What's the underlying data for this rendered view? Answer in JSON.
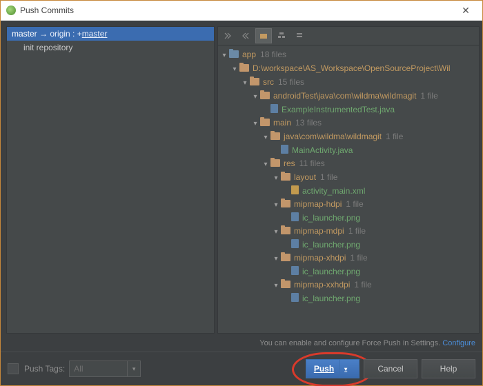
{
  "window": {
    "title": "Push Commits"
  },
  "left": {
    "branch_source": "master",
    "branch_arrow": "→",
    "branch_remote": "origin :",
    "branch_plus": "+",
    "branch_target": "master",
    "commits": [
      "init repository"
    ]
  },
  "tree": [
    {
      "d": 0,
      "exp": true,
      "kind": "F",
      "blue": true,
      "label": "app",
      "count": "18 files"
    },
    {
      "d": 1,
      "exp": true,
      "kind": "F",
      "blue": false,
      "label": "D:\\workspace\\AS_Workspace\\OpenSourceProject\\Wil",
      "count": ""
    },
    {
      "d": 2,
      "exp": true,
      "kind": "F",
      "blue": false,
      "label": "src",
      "count": "15 files"
    },
    {
      "d": 3,
      "exp": true,
      "kind": "F",
      "blue": false,
      "label": "androidTest\\java\\com\\wildma\\wildmagit",
      "count": "1 file"
    },
    {
      "d": 4,
      "exp": false,
      "kind": "J",
      "blue": false,
      "label": "ExampleInstrumentedTest.java",
      "count": ""
    },
    {
      "d": 3,
      "exp": true,
      "kind": "F",
      "blue": false,
      "label": "main",
      "count": "13 files"
    },
    {
      "d": 4,
      "exp": true,
      "kind": "F",
      "blue": false,
      "label": "java\\com\\wildma\\wildmagit",
      "count": "1 file"
    },
    {
      "d": 5,
      "exp": false,
      "kind": "J",
      "blue": false,
      "label": "MainActivity.java",
      "count": ""
    },
    {
      "d": 4,
      "exp": true,
      "kind": "F",
      "blue": false,
      "label": "res",
      "count": "11 files"
    },
    {
      "d": 5,
      "exp": true,
      "kind": "F",
      "blue": false,
      "label": "layout",
      "count": "1 file"
    },
    {
      "d": 6,
      "exp": false,
      "kind": "X",
      "blue": false,
      "label": "activity_main.xml",
      "count": ""
    },
    {
      "d": 5,
      "exp": true,
      "kind": "F",
      "blue": false,
      "label": "mipmap-hdpi",
      "count": "1 file"
    },
    {
      "d": 6,
      "exp": false,
      "kind": "I",
      "blue": false,
      "label": "ic_launcher.png",
      "count": ""
    },
    {
      "d": 5,
      "exp": true,
      "kind": "F",
      "blue": false,
      "label": "mipmap-mdpi",
      "count": "1 file"
    },
    {
      "d": 6,
      "exp": false,
      "kind": "I",
      "blue": false,
      "label": "ic_launcher.png",
      "count": ""
    },
    {
      "d": 5,
      "exp": true,
      "kind": "F",
      "blue": false,
      "label": "mipmap-xhdpi",
      "count": "1 file"
    },
    {
      "d": 6,
      "exp": false,
      "kind": "I",
      "blue": false,
      "label": "ic_launcher.png",
      "count": ""
    },
    {
      "d": 5,
      "exp": true,
      "kind": "F",
      "blue": false,
      "label": "mipmap-xxhdpi",
      "count": "1 file"
    },
    {
      "d": 6,
      "exp": false,
      "kind": "I",
      "blue": false,
      "label": "ic_launcher.png",
      "count": ""
    }
  ],
  "note": {
    "text": "You can enable and configure Force Push in Settings.",
    "link": "Configure"
  },
  "bottom": {
    "push_tags_label": "Push Tags:",
    "push_tags_combo": "All",
    "push": "Push",
    "cancel": "Cancel",
    "help": "Help"
  }
}
